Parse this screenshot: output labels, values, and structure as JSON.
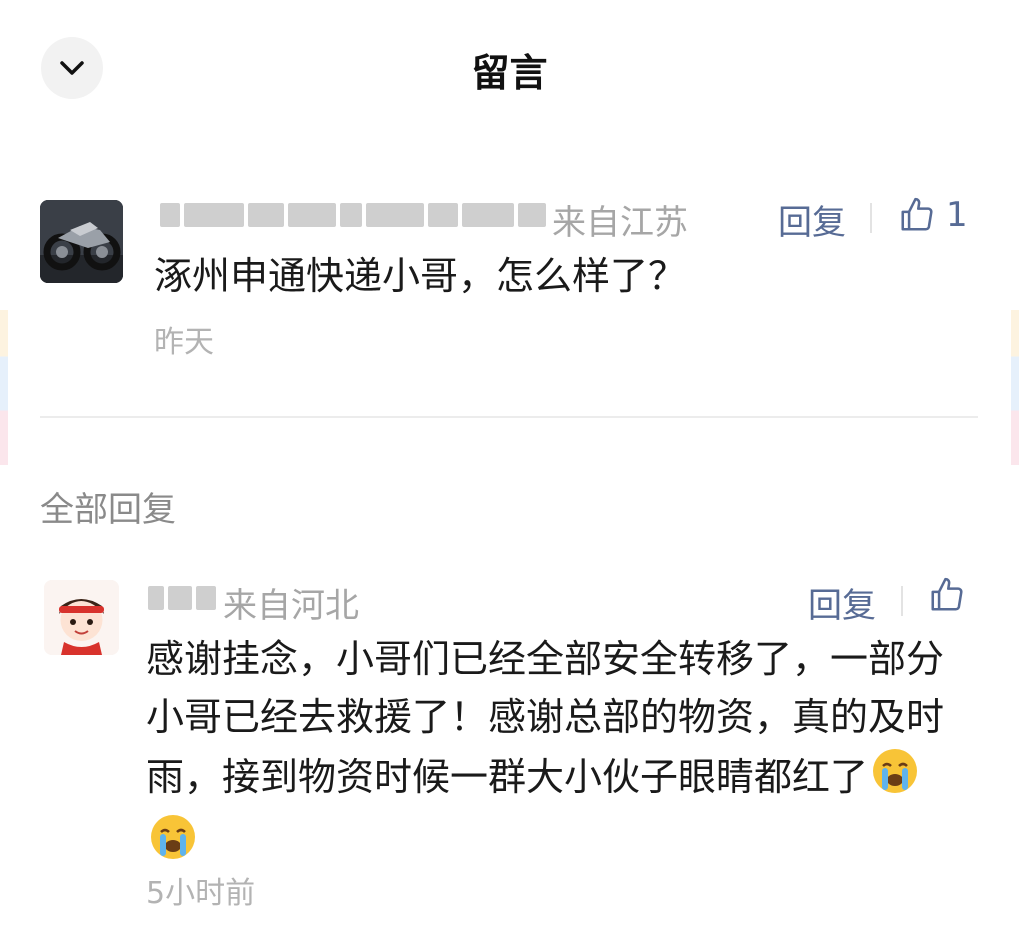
{
  "header": {
    "title": "留言",
    "back_icon": "chevron-down-icon"
  },
  "comment": {
    "location": "来自江苏",
    "reply_label": "回复",
    "like_count": "1",
    "text": "涿州申通快递小哥，怎么样了？",
    "time": "昨天"
  },
  "section": {
    "all_replies_label": "全部回复"
  },
  "reply": {
    "location": "来自河北",
    "reply_label": "回复",
    "text": "感谢挂念，小哥们已经全部安全转移了，一部分小哥已经去救援了！感谢总部的物资，真的及时雨，接到物资时候一群大小伙子眼睛都红了",
    "emojis": [
      "crying-face-emoji",
      "crying-face-emoji"
    ],
    "time": "5小时前"
  },
  "colors": {
    "link": "#576b95",
    "muted": "#a6a6a6",
    "text": "#1a1a1a"
  }
}
